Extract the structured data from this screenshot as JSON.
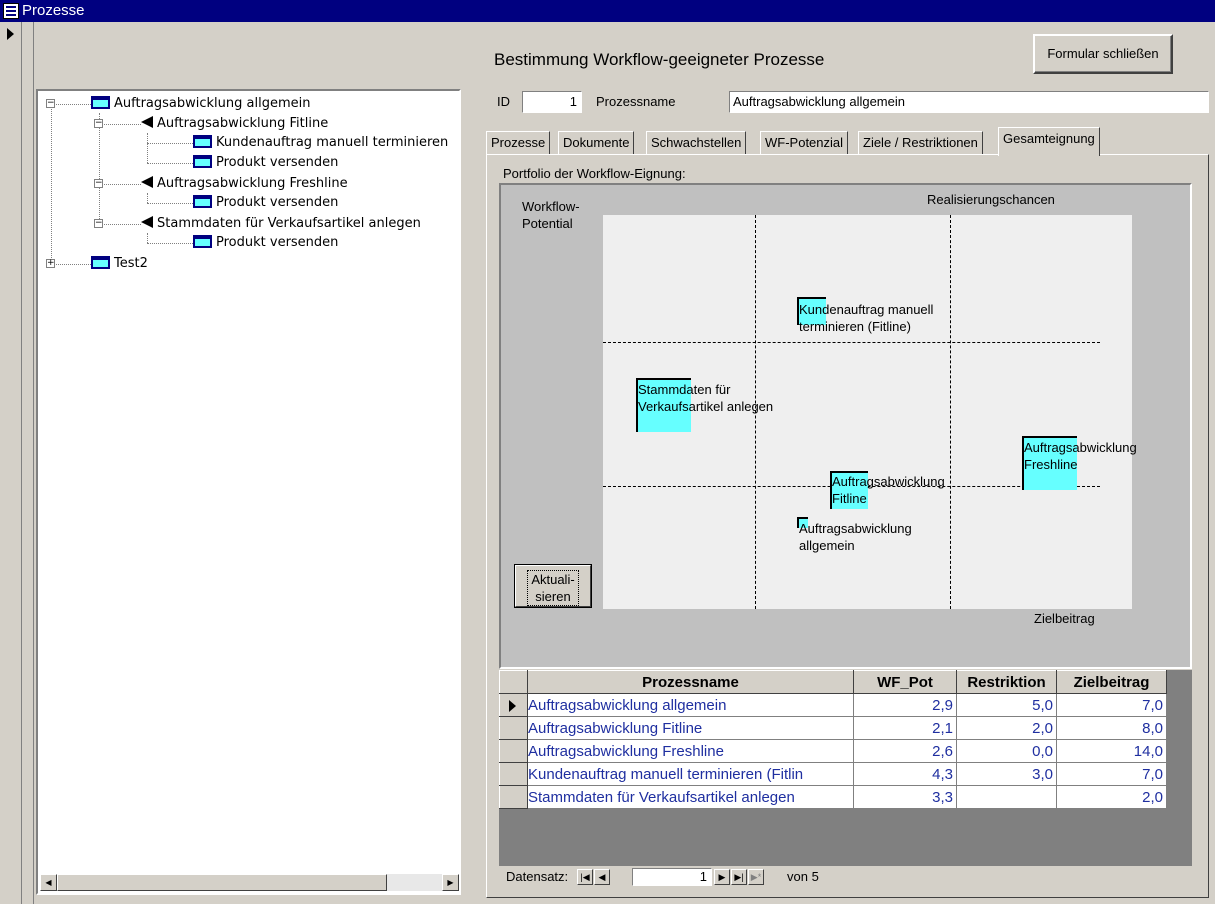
{
  "window": {
    "title": "Prozesse"
  },
  "header": {
    "heading": "Bestimmung Workflow-geeigneter Prozesse",
    "close_button": "Formular schließen"
  },
  "fields": {
    "id_label": "ID",
    "id_value": "1",
    "name_label": "Prozessname",
    "name_value": "Auftragsabwicklung allgemein"
  },
  "tree": {
    "nodes": [
      {
        "label": "Auftragsabwicklung allgemein",
        "icon": "process-box-icon"
      },
      {
        "label": "Auftragsabwicklung Fitline",
        "icon": "triangle-icon"
      },
      {
        "label": "Kundenauftrag manuell terminieren",
        "icon": "process-box-icon"
      },
      {
        "label": "Produkt versenden",
        "icon": "process-box-icon"
      },
      {
        "label": "Auftragsabwicklung Freshline",
        "icon": "triangle-icon"
      },
      {
        "label": "Produkt versenden",
        "icon": "process-box-icon"
      },
      {
        "label": "Stammdaten für Verkaufsartikel anlegen",
        "icon": "triangle-icon"
      },
      {
        "label": "Produkt versenden",
        "icon": "process-box-icon"
      },
      {
        "label": "Test2",
        "icon": "process-box-icon"
      }
    ]
  },
  "tabs": [
    {
      "label": "Prozesse"
    },
    {
      "label": "Dokumente"
    },
    {
      "label": "Schwachstellen"
    },
    {
      "label": "WF-Potenzial"
    },
    {
      "label": "Ziele / Restriktionen"
    },
    {
      "label": "Gesamteignung",
      "active": true
    }
  ],
  "portfolio": {
    "label": "Portfolio der Workflow-Eignung:",
    "y_label": "Workflow-\nPotential",
    "top_label": "Realisierungschancen",
    "x_label": "Zielbeitrag",
    "refresh_button": "Aktuali-\nsieren",
    "bubbles": [
      {
        "label": "Kundenauftrag manuell\nterminieren (Fitline)"
      },
      {
        "label": "Stammdaten für\nVerkaufsartikel anlegen"
      },
      {
        "label": "Auftragsabwicklung\nFreshline"
      },
      {
        "label": "Auftragsabwicklung\nFitline"
      },
      {
        "label": "Auftragsabwicklung\nallgemein"
      }
    ]
  },
  "table": {
    "columns": [
      "Prozessname",
      "WF_Pot",
      "Restriktion",
      "Zielbeitrag"
    ],
    "rows": [
      {
        "name": "Auftragsabwicklung allgemein",
        "wf_pot": "2,9",
        "restriktion": "5,0",
        "zielbeitrag": "7,0"
      },
      {
        "name": "Auftragsabwicklung Fitline",
        "wf_pot": "2,1",
        "restriktion": "2,0",
        "zielbeitrag": "8,0"
      },
      {
        "name": "Auftragsabwicklung Freshline",
        "wf_pot": "2,6",
        "restriktion": "0,0",
        "zielbeitrag": "14,0"
      },
      {
        "name": "Kundenauftrag manuell terminieren (Fitlin",
        "wf_pot": "4,3",
        "restriktion": "3,0",
        "zielbeitrag": "7,0"
      },
      {
        "name": "Stammdaten für Verkaufsartikel anlegen",
        "wf_pot": "3,3",
        "restriktion": "",
        "zielbeitrag": "2,0"
      }
    ]
  },
  "navigation": {
    "label": "Datensatz:",
    "current": "1",
    "of_label": "von 5"
  }
}
